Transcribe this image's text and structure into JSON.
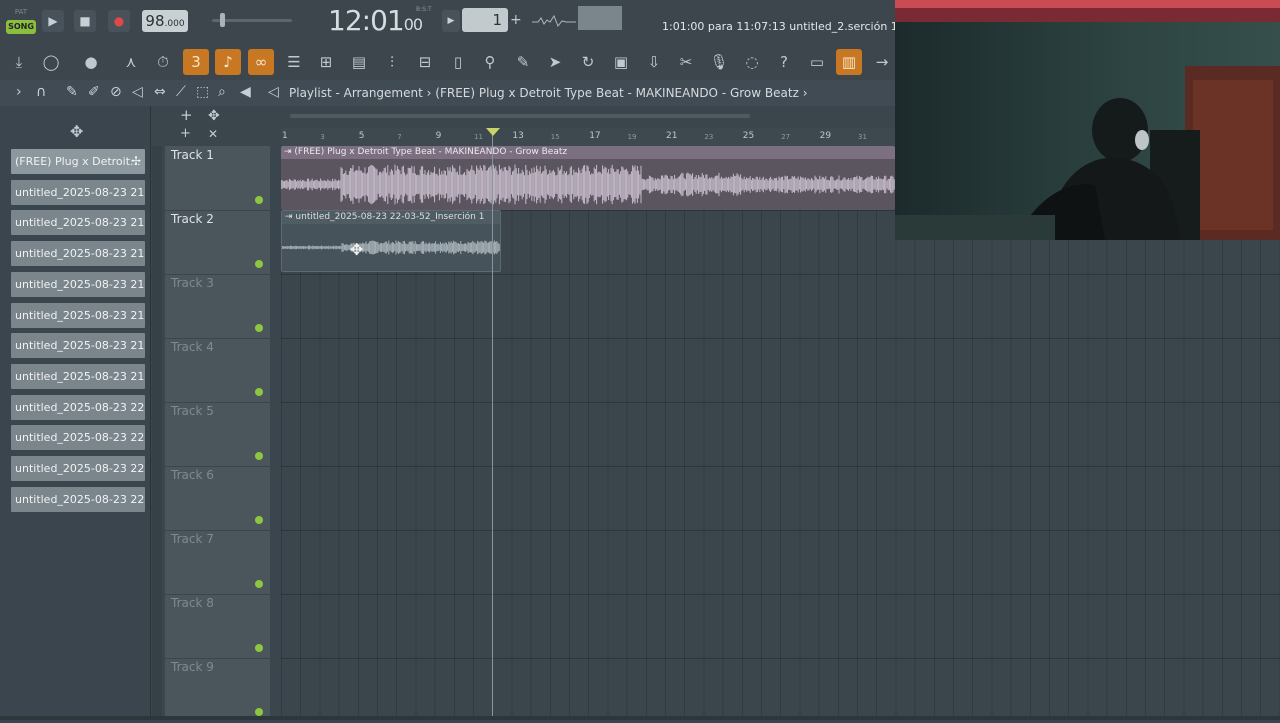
{
  "transport": {
    "mode_pat": "PAT",
    "mode_song": "SONG",
    "tempo_main": "98",
    "tempo_decimal": ".000",
    "time_main": "12:01",
    "time_sub": "00",
    "time_unit": "B:S:T",
    "pattern_number": "1",
    "hint_text": "1:01:00 para 11:07:13 untitled_2.serción 1"
  },
  "playlist": {
    "title": "Playlist - Arrangement",
    "separator": "›",
    "breadcrumb": "(FREE) Plug x Detroit Type Beat - MAKINEANDO - Grow Beatz",
    "breadcrumb_end": "›"
  },
  "browser": {
    "items": [
      "(FREE) Plug x Detroit...",
      "untitled_2025-08-23 21...",
      "untitled_2025-08-23 21...",
      "untitled_2025-08-23 21...",
      "untitled_2025-08-23 21...",
      "untitled_2025-08-23 21...",
      "untitled_2025-08-23 21...",
      "untitled_2025-08-23 21...",
      "untitled_2025-08-23 22...",
      "untitled_2025-08-23 22...",
      "untitled_2025-08-23 22...",
      "untitled_2025-08-23 22..."
    ]
  },
  "ruler": {
    "major": [
      "1",
      "5",
      "9",
      "13",
      "17",
      "21",
      "25",
      "29"
    ],
    "minor": [
      "3",
      "7",
      "11",
      "15",
      "19",
      "23",
      "27",
      "31"
    ]
  },
  "tracks": [
    {
      "label": "Track 1"
    },
    {
      "label": "Track 2"
    },
    {
      "label": "Track 3"
    },
    {
      "label": "Track 4"
    },
    {
      "label": "Track 5"
    },
    {
      "label": "Track 6"
    },
    {
      "label": "Track 7"
    },
    {
      "label": "Track 8"
    },
    {
      "label": "Track 9"
    }
  ],
  "clips": {
    "clip1_name": "(FREE) Plug x Detroit Type Beat - MAKINEANDO - Grow Beatz",
    "clip2_name": "untitled_2025-08-23 22-03-52_Inserción 1"
  },
  "icons": {
    "play": "▶",
    "stop": "■",
    "record": "●",
    "plus": "+",
    "cross": "✕"
  },
  "colors": {
    "song_mode": "#8bbf3a",
    "track_led": "#8dc63f",
    "clip1": "#5b5560",
    "accent_orange": "#c87822"
  }
}
